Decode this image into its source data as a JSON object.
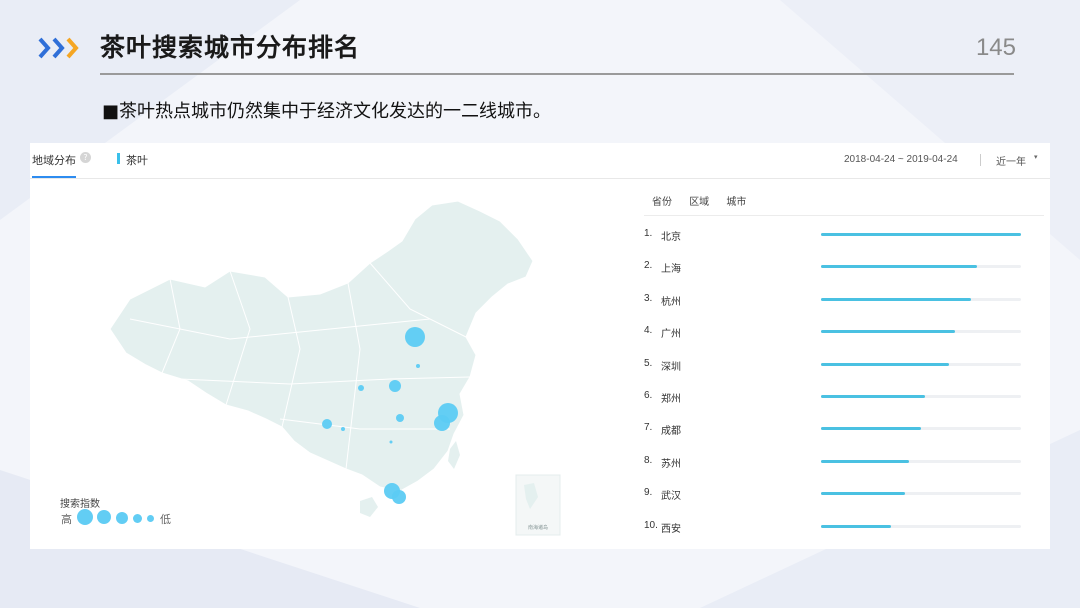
{
  "slide": {
    "title": "茶叶搜索城市分布排名",
    "page_number": "145",
    "bullet": "■茶叶热点城市仍然集中于经济文化发达的一二线城市。"
  },
  "panel": {
    "tab_label": "地域分布",
    "help_symbol": "?",
    "keyword": "茶叶",
    "date_range": "2018-04-24 ~ 2019-04-24",
    "period": "近一年",
    "period_caret": "▾"
  },
  "map": {
    "legend_title": "搜索指数",
    "legend_high": "高",
    "legend_low": "低",
    "inset_label": "南海诸岛"
  },
  "ranking": {
    "scope_tabs": [
      "省份",
      "区域",
      "城市"
    ],
    "items": [
      {
        "rank": "1.",
        "city": "北京",
        "value": 1.0
      },
      {
        "rank": "2.",
        "city": "上海",
        "value": 0.78
      },
      {
        "rank": "3.",
        "city": "杭州",
        "value": 0.75
      },
      {
        "rank": "4.",
        "city": "广州",
        "value": 0.67
      },
      {
        "rank": "5.",
        "city": "深圳",
        "value": 0.64
      },
      {
        "rank": "6.",
        "city": "郑州",
        "value": 0.52
      },
      {
        "rank": "7.",
        "city": "成都",
        "value": 0.5
      },
      {
        "rank": "8.",
        "city": "苏州",
        "value": 0.44
      },
      {
        "rank": "9.",
        "city": "武汉",
        "value": 0.42
      },
      {
        "rank": "10.",
        "city": "西安",
        "value": 0.35
      }
    ]
  },
  "colors": {
    "bar": "#4ac1e2",
    "bubble": "#5ccbf3",
    "map_land": "#e4f0ef",
    "accent_blue": "#2d8cf0",
    "chevron_orange": "#f5a623",
    "chevron_blue": "#2f6fd8"
  }
}
